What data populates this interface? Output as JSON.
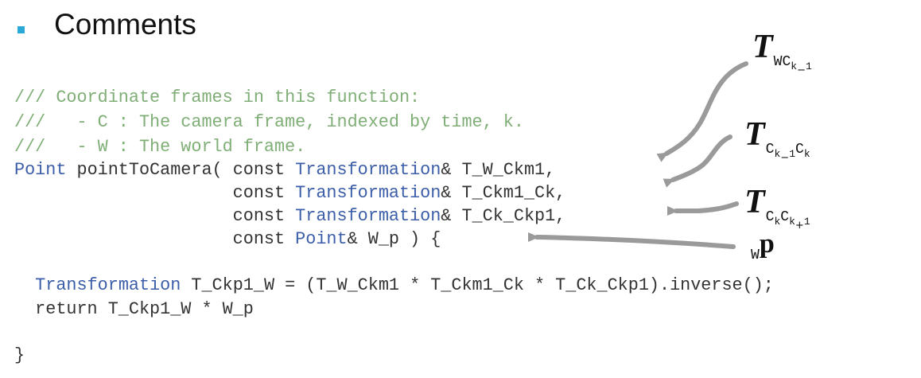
{
  "slide": {
    "bullet_color": "#2aa8d6",
    "heading": "Comments"
  },
  "code": {
    "comment_color": "#7fae76",
    "type_color": "#3c5ea9",
    "plain_color": "#333333",
    "lines": [
      [
        {
          "t": "/// Coordinate frames in this function:",
          "k": "comment"
        }
      ],
      [
        {
          "t": "///   - C : The camera frame, indexed by time, k.",
          "k": "comment"
        }
      ],
      [
        {
          "t": "///   - W : The world frame.",
          "k": "comment"
        }
      ],
      [
        {
          "t": "Point",
          "k": "type"
        },
        {
          "t": " pointToCamera( const ",
          "k": "plain"
        },
        {
          "t": "Transformation",
          "k": "type"
        },
        {
          "t": "& T_W_Ckm1,",
          "k": "plain"
        }
      ],
      [
        {
          "t": "                     const ",
          "k": "plain"
        },
        {
          "t": "Transformation",
          "k": "type"
        },
        {
          "t": "& T_Ckm1_Ck,",
          "k": "plain"
        }
      ],
      [
        {
          "t": "                     const ",
          "k": "plain"
        },
        {
          "t": "Transformation",
          "k": "type"
        },
        {
          "t": "& T_Ck_Ckp1,",
          "k": "plain"
        }
      ],
      [
        {
          "t": "                     const ",
          "k": "plain"
        },
        {
          "t": "Point",
          "k": "type"
        },
        {
          "t": "& W_p ) {",
          "k": "plain"
        }
      ],
      [
        {
          "t": "  ",
          "k": "plain"
        },
        {
          "t": "Transformation",
          "k": "type"
        },
        {
          "t": " T_Ckp1_W = (T_W_Ckm1 * T_Ckm1_Ck * T_Ck_Ckp1).inverse();",
          "k": "plain"
        }
      ],
      [
        {
          "t": "  return T_Ckp1_W * W_p",
          "k": "plain"
        }
      ],
      [
        {
          "t": "}",
          "k": "plain"
        }
      ]
    ]
  },
  "annotations": {
    "t_w_ckm1": {
      "symbol": "T",
      "sub": "WC",
      "sub2": "k",
      "op": "−",
      "num": "1"
    },
    "t_ckm1_ck": {
      "symbol": "T",
      "sub": "C",
      "sub2": "k",
      "op": "−",
      "num": "1",
      "sub3": "C",
      "sub4": "k"
    },
    "t_ck_ckp1": {
      "symbol": "T",
      "sub": "C",
      "sub2": "k",
      "sub3": "C",
      "sub4": "k",
      "op": "+",
      "num": "1"
    },
    "w_p": {
      "pre": "W",
      "symbol": "p"
    },
    "arrow_color": "#9a9a9a"
  }
}
